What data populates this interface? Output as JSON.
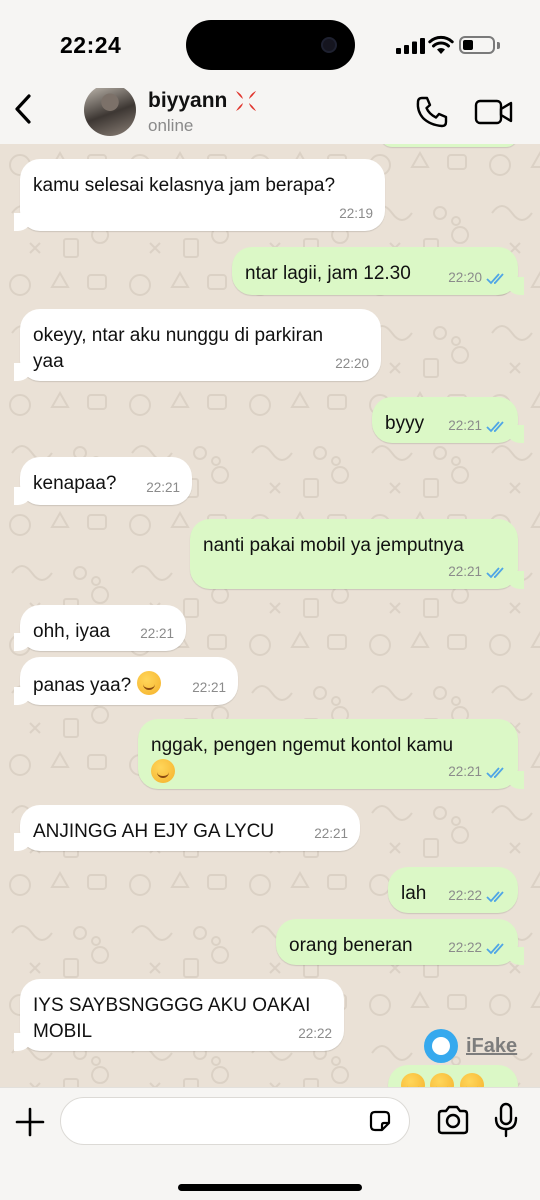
{
  "status_bar": {
    "time": "22:24",
    "battery_level": 0.35,
    "signal_bars": 4
  },
  "header": {
    "contact_name": "biyyann",
    "contact_emoji": "anger-symbol-icon",
    "contact_status": "online",
    "icons": [
      "back-chevron-icon",
      "phone-icon",
      "video-camera-icon"
    ]
  },
  "messages": [
    {
      "side": "in",
      "text": "kamu selesai kelasnya jam berapa?",
      "time": "22:19"
    },
    {
      "side": "out",
      "text": "ntar lagii, jam 12.30",
      "time": "22:20",
      "read": true
    },
    {
      "side": "in",
      "text": "okeyy, ntar aku nunggu di parkiran\nyaa",
      "time": "22:20"
    },
    {
      "side": "out",
      "text": "byyy",
      "time": "22:21",
      "read": true
    },
    {
      "side": "in",
      "text": "kenapaa?",
      "time": "22:21"
    },
    {
      "side": "out",
      "text": "nanti pakai mobil ya jemputnya",
      "time": "22:21",
      "read": true
    },
    {
      "side": "in",
      "text": "ohh, iyaa",
      "time": "22:21"
    },
    {
      "side": "in",
      "text": "panas yaa?",
      "emoji": "kissing-face-icon",
      "time": "22:21"
    },
    {
      "side": "out",
      "text": "nggak, pengen ngemut kontol kamu",
      "emoji": "pleading-face-icon",
      "time": "22:21",
      "read": true
    },
    {
      "side": "in",
      "text": "ANJINGG AH EJY GA LYCU",
      "time": "22:21"
    },
    {
      "side": "out",
      "text": "lah",
      "time": "22:22",
      "read": true
    },
    {
      "side": "out",
      "text": "orang beneran",
      "time": "22:22",
      "read": true
    },
    {
      "side": "in",
      "text": "IYS SAYBSNGGGG AKU OAKAI\nMOBIL",
      "time": "22:22"
    },
    {
      "side": "out",
      "emoji": "three-faces-partial",
      "text": "",
      "time": ""
    }
  ],
  "watermark": {
    "text": "iFake"
  },
  "input_bar": {
    "placeholder": "",
    "icons": [
      "plus-icon",
      "sticker-icon",
      "camera-icon",
      "microphone-icon"
    ]
  },
  "colors": {
    "incoming_bubble": "#ffffff",
    "outgoing_bubble": "#dbf8c6",
    "read_ticks": "#4fa5e6",
    "wallpaper": "#eae1d6"
  }
}
